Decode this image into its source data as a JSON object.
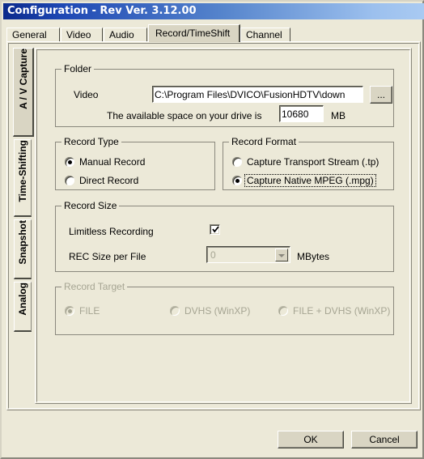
{
  "window": {
    "title": "Configuration - Rev Ver. 3.12.00"
  },
  "tabs": [
    {
      "label": "General",
      "active": false
    },
    {
      "label": "Video",
      "active": false
    },
    {
      "label": "Audio",
      "active": false
    },
    {
      "label": "Record/TimeShift",
      "active": true
    },
    {
      "label": "Channel",
      "active": false
    }
  ],
  "side_tabs": [
    {
      "label": "A / V Capture",
      "active": true
    },
    {
      "label": "Time-Shifting",
      "active": false
    },
    {
      "label": "Snapshot",
      "active": false
    },
    {
      "label": "Analog",
      "active": false
    }
  ],
  "folder": {
    "title": "Folder",
    "video_label": "Video",
    "video_path": "C:\\Program Files\\DVICO\\FusionHDTV\\down",
    "browse_label": "...",
    "space_label": "The available space on your drive is",
    "space_value": "10680",
    "space_units": "MB"
  },
  "record_type": {
    "title": "Record Type",
    "options": [
      {
        "label": "Manual Record",
        "selected": true
      },
      {
        "label": "Direct Record",
        "selected": false
      }
    ]
  },
  "record_format": {
    "title": "Record Format",
    "options": [
      {
        "label": "Capture Transport Stream (.tp)",
        "selected": false,
        "focused": false
      },
      {
        "label": "Capture Native MPEG (.mpg)",
        "selected": true,
        "focused": true
      }
    ]
  },
  "record_size": {
    "title": "Record Size",
    "limitless_label": "Limitless Recording",
    "limitless_checked": true,
    "rec_size_label": "REC Size per File",
    "rec_size_value": "0",
    "rec_size_units": "MBytes"
  },
  "record_target": {
    "title": "Record Target",
    "disabled": true,
    "options": [
      {
        "label": "FILE",
        "selected": true
      },
      {
        "label": "DVHS (WinXP)",
        "selected": false
      },
      {
        "label": "FILE + DVHS (WinXP)",
        "selected": false
      }
    ]
  },
  "footer": {
    "ok_label": "OK",
    "cancel_label": "Cancel"
  },
  "colors": {
    "face": "#ece9d8",
    "title_start": "#0b2a8c",
    "title_end": "#a9caf2",
    "disabled_text": "#a6a593",
    "field_bg": "#ffffff"
  }
}
